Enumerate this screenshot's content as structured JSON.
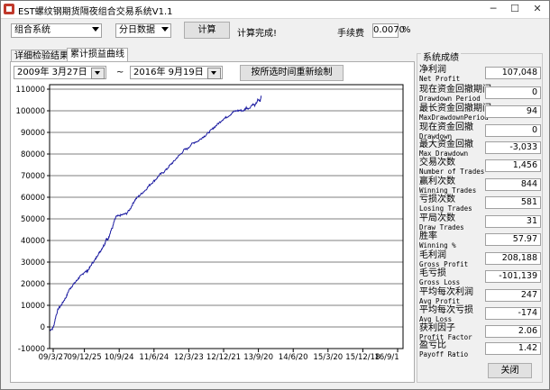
{
  "window": {
    "title": "EST螺纹钢期货隔夜组合交易系统V1.1",
    "minimize": "─",
    "maximize": "☐",
    "close": "✕"
  },
  "toolbar": {
    "combo_system": "组合系统",
    "combo_data": "分日数据",
    "calc_button": "计算",
    "status": "计算完成!",
    "fee_label": "手续费",
    "fee_value": "0.0070",
    "fee_unit": "%"
  },
  "tabs": [
    {
      "label": "详细检验结果",
      "active": false
    },
    {
      "label": "累计损益曲线",
      "active": true
    }
  ],
  "date_range": {
    "start": "2009年  3月27日",
    "separator": "~",
    "end": "2016年  9月19日",
    "redraw_button": "按所选时间重新绘制"
  },
  "chart_data": {
    "type": "line",
    "x_tick_labels": [
      "09/3/27",
      "09/12/25",
      "10/9/24",
      "11/6/24",
      "12/3/23",
      "12/12/21",
      "13/9/20",
      "14/6/20",
      "15/3/20",
      "15/12/18",
      "16/9/1"
    ],
    "y_ticks": [
      -10000,
      0,
      10000,
      20000,
      30000,
      40000,
      50000,
      60000,
      70000,
      80000,
      90000,
      100000,
      110000
    ],
    "ylim": [
      -10000,
      110000
    ],
    "grid": "horizontal",
    "line_color": "#1a1aa0",
    "series": [
      {
        "values": [
          [
            0,
            -1500
          ],
          [
            0.08,
            -800
          ],
          [
            0.12,
            500
          ],
          [
            0.18,
            5000
          ],
          [
            0.25,
            8500
          ],
          [
            0.33,
            10000
          ],
          [
            0.4,
            12000
          ],
          [
            0.48,
            14000
          ],
          [
            0.55,
            17000
          ],
          [
            0.62,
            18500
          ],
          [
            0.7,
            20000
          ],
          [
            0.78,
            21500
          ],
          [
            0.85,
            23000
          ],
          [
            0.92,
            24000
          ],
          [
            1.0,
            25500
          ],
          [
            1.08,
            25800
          ],
          [
            1.15,
            27500
          ],
          [
            1.22,
            29500
          ],
          [
            1.3,
            31000
          ],
          [
            1.38,
            33500
          ],
          [
            1.45,
            35000
          ],
          [
            1.52,
            37000
          ],
          [
            1.58,
            38500
          ],
          [
            1.62,
            41000
          ],
          [
            1.66,
            40000
          ],
          [
            1.7,
            42000
          ],
          [
            1.75,
            44500
          ],
          [
            1.8,
            46000
          ],
          [
            1.85,
            49000
          ],
          [
            1.9,
            51000
          ],
          [
            2.0,
            51500
          ],
          [
            2.1,
            52000
          ],
          [
            2.2,
            52500
          ],
          [
            2.3,
            54500
          ],
          [
            2.38,
            57000
          ],
          [
            2.45,
            59000
          ],
          [
            2.55,
            60500
          ],
          [
            2.65,
            62000
          ],
          [
            2.75,
            63500
          ],
          [
            2.85,
            65500
          ],
          [
            2.95,
            67000
          ],
          [
            3.05,
            68500
          ],
          [
            3.15,
            70500
          ],
          [
            3.25,
            71500
          ],
          [
            3.35,
            73000
          ],
          [
            3.45,
            75000
          ],
          [
            3.55,
            76500
          ],
          [
            3.65,
            78500
          ],
          [
            3.75,
            80000
          ],
          [
            3.85,
            82000
          ],
          [
            3.95,
            82500
          ],
          [
            4.05,
            84500
          ],
          [
            4.15,
            85500
          ],
          [
            4.25,
            86000
          ],
          [
            4.35,
            87500
          ],
          [
            4.45,
            88500
          ],
          [
            4.55,
            90000
          ],
          [
            4.65,
            91500
          ],
          [
            4.75,
            93000
          ],
          [
            4.85,
            94500
          ],
          [
            4.95,
            96000
          ],
          [
            5.05,
            97000
          ],
          [
            5.15,
            98000
          ],
          [
            5.25,
            99500
          ],
          [
            5.35,
            100000
          ],
          [
            5.45,
            100200
          ],
          [
            5.55,
            100000
          ],
          [
            5.62,
            101500
          ],
          [
            5.7,
            101000
          ],
          [
            5.8,
            103000
          ],
          [
            5.88,
            102500
          ],
          [
            5.95,
            105000
          ],
          [
            6.02,
            104500
          ],
          [
            6.05,
            107000
          ]
        ]
      }
    ]
  },
  "stats": {
    "title": "系统成绩",
    "rows": [
      {
        "cn": "净利润",
        "en": "Net Profit",
        "value": "107,048"
      },
      {
        "cn": "现在资金回撤期间",
        "en": "Drawdown Period",
        "value": "0"
      },
      {
        "cn": "最长资金回撤期间",
        "en": "MaxDrawdownPeriod",
        "value": "94"
      },
      {
        "cn": "现在资金回撤",
        "en": "Drawdown",
        "value": "0"
      },
      {
        "cn": "最大资金回撤",
        "en": "Max Drawdown",
        "value": "-3,033"
      },
      {
        "cn": "交易次数",
        "en": "Number of Trades",
        "value": "1,456"
      },
      {
        "cn": "赢利次数",
        "en": "Winning Trades",
        "value": "844"
      },
      {
        "cn": "亏损次数",
        "en": "Losing Trades",
        "value": "581"
      },
      {
        "cn": "平局次数",
        "en": "Draw Trades",
        "value": "31"
      },
      {
        "cn": "胜率",
        "en": "Winning %",
        "value": "57.97"
      },
      {
        "cn": "毛利润",
        "en": "Gross Profit",
        "value": "208,188"
      },
      {
        "cn": "毛亏损",
        "en": "Gross Loss",
        "value": "-101,139"
      },
      {
        "cn": "平均每次利润",
        "en": "Avg Profit",
        "value": "247"
      },
      {
        "cn": "平均每次亏损",
        "en": "Avg Loss",
        "value": "-174"
      },
      {
        "cn": "获利因子",
        "en": "Profit Factor",
        "value": "2.06"
      },
      {
        "cn": "盈亏比",
        "en": "Payoff Ratio",
        "value": "1.42"
      }
    ],
    "close_button": "关闭"
  }
}
